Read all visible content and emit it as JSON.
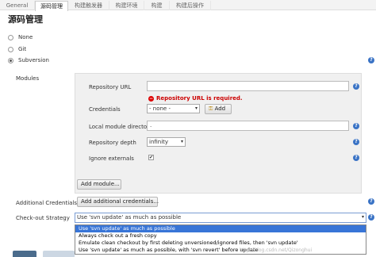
{
  "tabs": [
    "General",
    "源码管理",
    "构建触发器",
    "构建环境",
    "构建",
    "构建后操作"
  ],
  "section_title": "源码管理",
  "scm_options": [
    "None",
    "Git",
    "Subversion"
  ],
  "modules_label": "Modules",
  "repo_url": {
    "label": "Repository URL",
    "value": "",
    "error": "Repository URL is required."
  },
  "credentials": {
    "label": "Credentials",
    "value": "- none -",
    "add_label": "Add"
  },
  "local_dir": {
    "label": "Local module directory",
    "value": "."
  },
  "depth": {
    "label": "Repository depth",
    "value": "infinity"
  },
  "ignore_externals": {
    "label": "Ignore externals",
    "checked": true
  },
  "add_module_label": "Add module...",
  "additional_credentials": {
    "label": "Additional Credentials",
    "button": "Add additional credentials..."
  },
  "checkout_strategy": {
    "label": "Check-out Strategy",
    "value": "Use 'svn update' as much as possible",
    "options": [
      "Use 'svn update' as much as possible",
      "Always check out a fresh copy",
      "Emulate clean checkout by first deleting unversioned/ignored files, then 'svn update'",
      "Use 'svn update' as much as possible, with 'svn revert' before update"
    ]
  },
  "watermark": "http://blog.csdn.net/Qizonghui",
  "icons": {
    "help": "question-circle-icon",
    "error": "minus-circle-icon",
    "key": "key-icon",
    "checkmark": "checkmark-icon"
  },
  "colors": {
    "error": "#cc0000",
    "selected_option": "#3875d7",
    "help": "#3a73c5"
  }
}
